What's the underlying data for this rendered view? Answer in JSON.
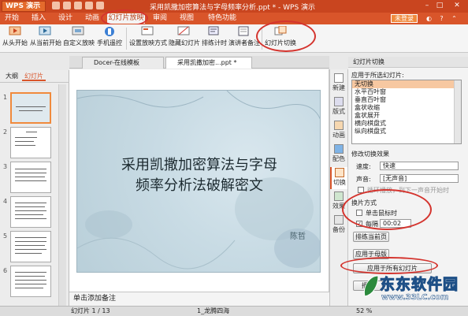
{
  "app": {
    "button": "WPS 演示",
    "title": "采用凯撒加密算法与字母频率分析.ppt * - WPS 演示"
  },
  "menu": [
    "开始",
    "插入",
    "设计",
    "动画",
    "幻灯片放映",
    "审阅",
    "视图",
    "特色功能"
  ],
  "menu_active": "幻灯片放映",
  "login": "未登录",
  "ribbon": [
    "从头开始",
    "从当前开始",
    "自定义放映",
    "手机遥控",
    "设置放映方式",
    "隐藏幻灯片",
    "排练计时",
    "演讲者备注",
    "幻灯片切换"
  ],
  "doc_tabs": [
    "Docer-在线模板",
    "采用凯撒加密...ppt *"
  ],
  "left_tabs": [
    "大纲",
    "幻灯片"
  ],
  "thumbs": [
    "1",
    "2",
    "3",
    "4",
    "5",
    "6"
  ],
  "slide": {
    "title_line1": "采用凯撒加密算法与字母",
    "title_line2": "频率分析法破解密文",
    "author": "陈哲"
  },
  "notes_placeholder": "单击添加备注",
  "status": {
    "slide": "幻灯片 1 / 13",
    "theme": "1_龙腾四海",
    "zoom": "52 %"
  },
  "side_tools": [
    "新建",
    "版式",
    "动画",
    "配色",
    "切换",
    "效果",
    "备份"
  ],
  "transition": {
    "header": "幻灯片切换",
    "apply_label": "应用于所选幻灯片:",
    "list": [
      "无切换",
      "水平百叶窗",
      "垂直百叶窗",
      "盒状收缩",
      "盒状展开",
      "横向棋盘式",
      "纵向棋盘式"
    ],
    "selected": "无切换",
    "modify_label": "修改切换效果",
    "speed_label": "速度:",
    "speed_value": "快速",
    "sound_label": "声音:",
    "sound_value": "[无声音]",
    "loop_label": "循环播放，到下一声音开始时",
    "mode_label": "换片方式",
    "on_click": "单击鼠标时",
    "every": "每隔",
    "every_value": "00:02",
    "rehearse": "排练当前页",
    "apply_master": "应用于母版",
    "apply_all": "应用于所有幻灯片",
    "play": "播放"
  },
  "watermark": {
    "cn": "东东软件园",
    "url": "www.33LC.com"
  },
  "colors": {
    "brand": "#d9552a",
    "highlight": "#d4342e",
    "selected": "#f7c8a1"
  }
}
